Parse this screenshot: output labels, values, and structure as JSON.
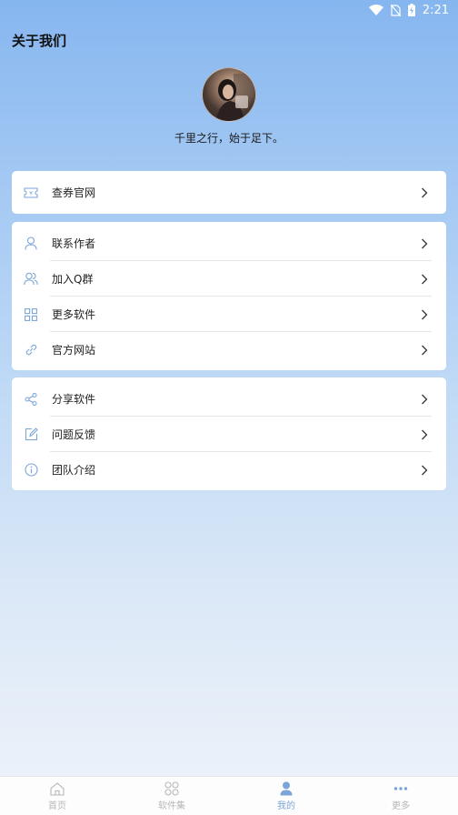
{
  "status_bar": {
    "time": "2:21",
    "icons": [
      "wifi-icon",
      "no-sim-icon",
      "battery-charging-icon"
    ]
  },
  "header": {
    "title": "关于我们"
  },
  "profile": {
    "motto": "千里之行，始于足下。"
  },
  "groups": [
    {
      "items": [
        {
          "icon": "ticket-icon",
          "label": "查券官网"
        }
      ]
    },
    {
      "items": [
        {
          "icon": "person-icon",
          "label": "联系作者"
        },
        {
          "icon": "group-icon",
          "label": "加入Q群"
        },
        {
          "icon": "grid-icon",
          "label": "更多软件"
        },
        {
          "icon": "link-icon",
          "label": "官方网站"
        }
      ]
    },
    {
      "items": [
        {
          "icon": "share-icon",
          "label": "分享软件"
        },
        {
          "icon": "edit-icon",
          "label": "问题反馈"
        },
        {
          "icon": "info-icon",
          "label": "团队介绍"
        }
      ]
    }
  ],
  "tab_bar": {
    "tabs": [
      {
        "icon": "home-icon",
        "label": "首页",
        "active": false
      },
      {
        "icon": "apps-icon",
        "label": "软件集",
        "active": false
      },
      {
        "icon": "user-icon",
        "label": "我的",
        "active": true
      },
      {
        "icon": "more-icon",
        "label": "更多",
        "active": false
      }
    ]
  },
  "colors": {
    "accent": "#7ba5d8",
    "bg_top": "#86b6ef",
    "bg_bottom": "#eef3fa"
  }
}
